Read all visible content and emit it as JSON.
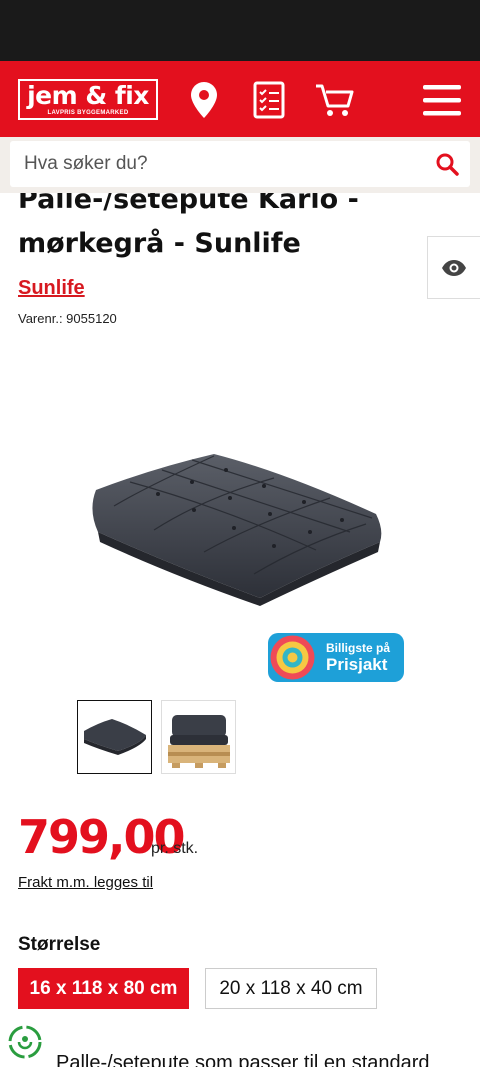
{
  "header": {
    "logo_text": "jem & fix",
    "logo_tagline": "LAVPRIS BYGGEMARKED",
    "icons": [
      "location-pin-icon",
      "checklist-icon",
      "cart-icon",
      "hamburger-menu-icon"
    ],
    "brand_color": "#e3101e"
  },
  "search": {
    "placeholder": "Hva søker du?"
  },
  "product": {
    "title": "Palle-/setepute Karlo - mørkegrå - Sunlife",
    "brand": "Sunlife",
    "sku": "Varenr.: 9055120",
    "price": "799,00",
    "unit": "pr. stk.",
    "shipping": "Frakt m.m. legges til",
    "description": "Palle-/setepute som passer til en standard"
  },
  "prisjakt": {
    "small": "Billigste på",
    "big": "Prisjakt"
  },
  "gallery": {
    "selected_index": 0,
    "thumbnails": [
      "Palle-/setepute Karlo",
      "Palle-/setepute Karlo"
    ]
  },
  "size": {
    "label": "Størrelse",
    "options": [
      "16 x 118 x 80 cm",
      "20 x 118 x 40 cm"
    ],
    "selected": "16 x 118 x 80 cm"
  }
}
